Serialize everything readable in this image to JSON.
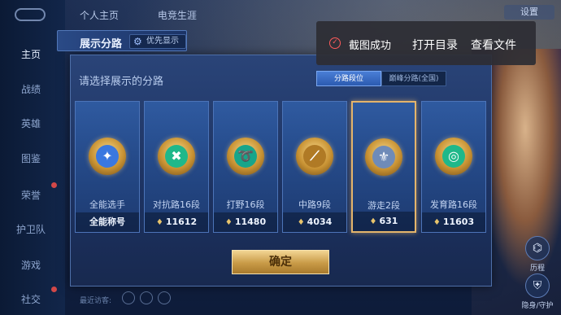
{
  "nav": {
    "items": [
      {
        "label": "主页",
        "active": true
      },
      {
        "label": "战绩"
      },
      {
        "label": "英雄"
      },
      {
        "label": "图鉴"
      },
      {
        "label": "荣誉"
      },
      {
        "label": "护卫队"
      },
      {
        "label": "游戏"
      },
      {
        "label": "社交"
      }
    ]
  },
  "top": {
    "tabs": [
      "个人主页",
      "电竞生涯"
    ],
    "settings_label": "设置"
  },
  "dialog": {
    "title": "展示分路",
    "pref_button": "优先显示",
    "prompt": "请选择展示的分路",
    "filter_active": "分路段位",
    "filter_inactive": "巅峰分路(全国)",
    "confirm": "确定",
    "cards": [
      {
        "name": "全能选手",
        "footer": "全能称号",
        "has_score": false,
        "icon": "all-round-icon",
        "symbol": "✦",
        "color": "#3a78e0"
      },
      {
        "name": "对抗路16段",
        "footer": "11612",
        "has_score": true,
        "icon": "clash-lane-icon",
        "symbol": "✖",
        "color": "#1fb88a"
      },
      {
        "name": "打野16段",
        "footer": "11480",
        "has_score": true,
        "icon": "jungle-icon",
        "symbol": "➰",
        "color": "#18a58a"
      },
      {
        "name": "中路9段",
        "footer": "4034",
        "has_score": true,
        "icon": "mid-lane-icon",
        "symbol": "⟋",
        "color": "#b07a25"
      },
      {
        "name": "游走2段",
        "footer": "631",
        "has_score": true,
        "icon": "roam-icon",
        "symbol": "⚜",
        "color": "#6f8bb8",
        "selected": true
      },
      {
        "name": "发育路16段",
        "footer": "11603",
        "has_score": true,
        "icon": "farm-lane-icon",
        "symbol": "◎",
        "color": "#1fb88a"
      }
    ]
  },
  "toast": {
    "message": "截图成功",
    "open_folder": "打开目录",
    "view_file": "查看文件"
  },
  "side": {
    "top_label": "历程",
    "bottom_label": "隐身/守护"
  },
  "bottom": {
    "hint": "最近访客:"
  }
}
